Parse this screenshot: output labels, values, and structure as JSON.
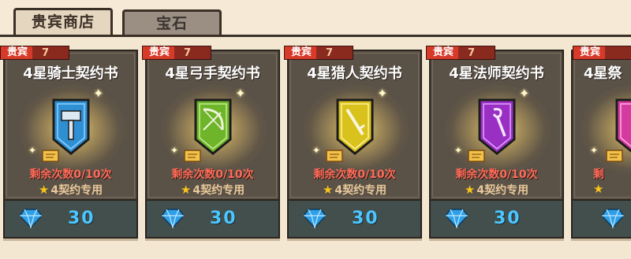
{
  "tabs": [
    {
      "label": "贵宾商店",
      "active": true
    },
    {
      "label": "宝石",
      "active": false
    }
  ],
  "cards": [
    {
      "vip_label": "贵宾",
      "vip_level": "7",
      "title": "4星骑士契约书",
      "icon": "knight-hammer-icon",
      "banner_color": "#2f8fd3",
      "remaining": "剩余次数0/10次",
      "usage": "4契约专用",
      "price": "30"
    },
    {
      "vip_label": "贵宾",
      "vip_level": "7",
      "title": "4星弓手契约书",
      "icon": "archer-bow-icon",
      "banner_color": "#6fb52b",
      "remaining": "剩余次数0/10次",
      "usage": "4契约专用",
      "price": "30"
    },
    {
      "vip_label": "贵宾",
      "vip_level": "7",
      "title": "4星猎人契约书",
      "icon": "hunter-rifle-icon",
      "banner_color": "#d9c21b",
      "remaining": "剩余次数0/10次",
      "usage": "4契约专用",
      "price": "30"
    },
    {
      "vip_label": "贵宾",
      "vip_level": "7",
      "title": "4星法师契约书",
      "icon": "mage-staff-icon",
      "banner_color": "#9a2fc4",
      "remaining": "剩余次数0/10次",
      "usage": "4契约专用",
      "price": "30"
    },
    {
      "vip_label": "贵宾",
      "vip_level": "",
      "title": "4星祭",
      "icon": "priest-icon",
      "banner_color": "#d43aa0",
      "remaining": "剩",
      "usage": "",
      "price": ""
    }
  ]
}
